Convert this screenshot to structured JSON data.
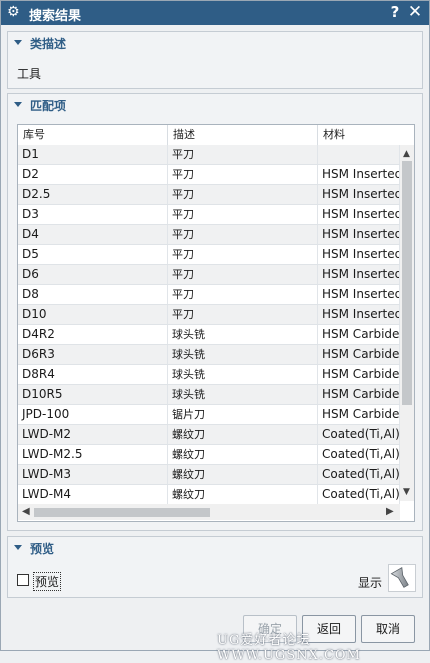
{
  "window": {
    "title": "搜索结果",
    "help": "?",
    "close": "✕"
  },
  "class_group": {
    "title": "类描述",
    "value": "工具"
  },
  "match_group": {
    "title": "匹配项",
    "columns": [
      "库号",
      "描述",
      "材料"
    ],
    "rows": [
      [
        "D1",
        "平刀",
        ""
      ],
      [
        "D2",
        "平刀",
        "HSM Inserted"
      ],
      [
        "D2.5",
        "平刀",
        "HSM Inserted"
      ],
      [
        "D3",
        "平刀",
        "HSM Inserted"
      ],
      [
        "D4",
        "平刀",
        "HSM Inserted"
      ],
      [
        "D5",
        "平刀",
        "HSM Inserted"
      ],
      [
        "D6",
        "平刀",
        "HSM Inserted"
      ],
      [
        "D8",
        "平刀",
        "HSM Inserted"
      ],
      [
        "D10",
        "平刀",
        "HSM Inserted"
      ],
      [
        "D4R2",
        "球头铣",
        "HSM Carbide"
      ],
      [
        "D6R3",
        "球头铣",
        "HSM Carbide"
      ],
      [
        "D8R4",
        "球头铣",
        "HSM Carbide"
      ],
      [
        "D10R5",
        "球头铣",
        "HSM Carbide"
      ],
      [
        "JPD-100",
        "锯片刀",
        "HSM Carbide"
      ],
      [
        "LWD-M2",
        "螺纹刀",
        "Coated(Ti,Al)"
      ],
      [
        "LWD-M2.5",
        "螺纹刀",
        "Coated(Ti,Al)"
      ],
      [
        "LWD-M3",
        "螺纹刀",
        "Coated(Ti,Al)"
      ],
      [
        "LWD-M4",
        "螺纹刀",
        "Coated(Ti,Al)"
      ]
    ]
  },
  "preview_group": {
    "title": "预览",
    "checkbox_label": "预览",
    "checked": false,
    "show_label": "显示"
  },
  "buttons": {
    "ok": "确定",
    "back": "返回",
    "cancel": "取消"
  },
  "watermark": "UG爱好者论坛 WWW.UGSNX.COM"
}
